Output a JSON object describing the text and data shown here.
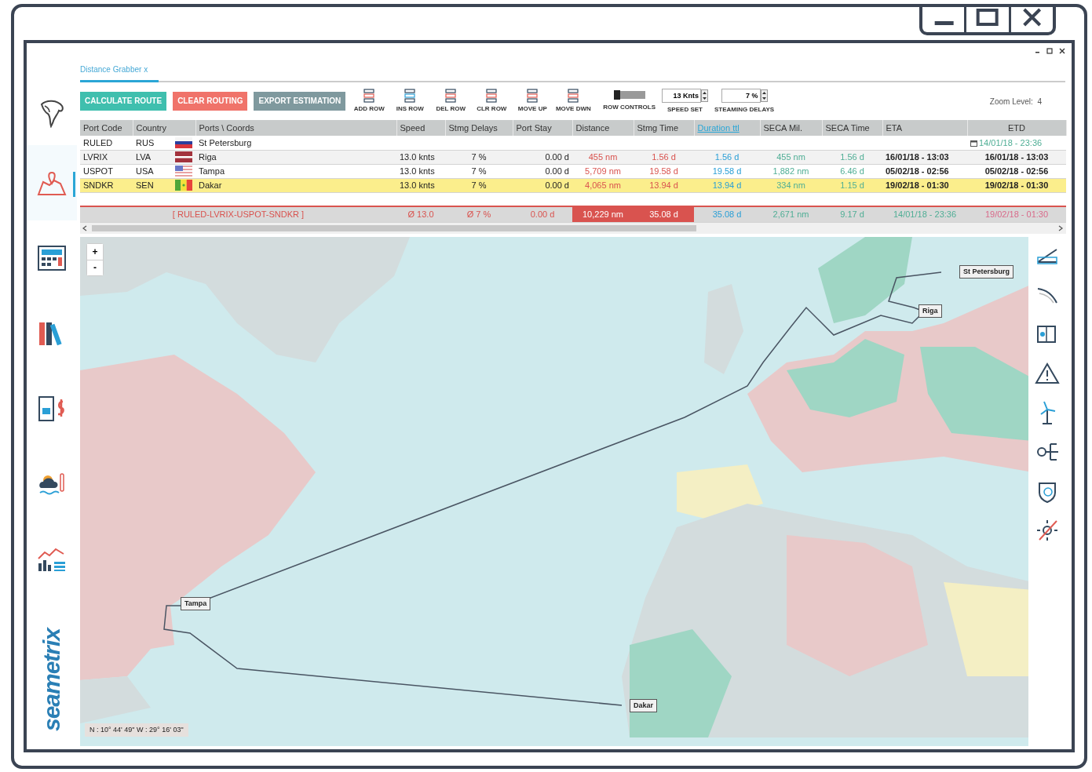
{
  "sidebar": {
    "logo": "seametrix",
    "items": [
      {
        "selected": true
      },
      {
        "selected": false
      },
      {
        "selected": false
      },
      {
        "selected": false
      },
      {
        "selected": false
      },
      {
        "selected": false
      }
    ]
  },
  "tabs": [
    {
      "label": "Distance Grabber x",
      "selected": true
    }
  ],
  "toolbar": {
    "buttons": [
      {
        "label": "CALCULATE ROUTE",
        "color": "#3fbfae"
      },
      {
        "label": "CLEAR ROUTING",
        "color": "#f0736a"
      },
      {
        "label": "EXPORT ESTIMATION",
        "color": "#7f999e"
      }
    ],
    "row_tools": [
      "ADD ROW",
      "INS ROW",
      "DEL ROW",
      "CLR ROW",
      "MOVE UP",
      "MOVE DWN"
    ],
    "row_controls": "ROW CONTROLS",
    "speed": {
      "value": "13 Knts",
      "label": "SPEED SET"
    },
    "delays": {
      "value": "7 %",
      "label": "STEAMING DELAYS"
    },
    "zoom_level": "Zoom Level:  4"
  },
  "table": {
    "columns": [
      {
        "label": "Port Code",
        "selected": false
      },
      {
        "label": "Country",
        "selected": false
      },
      {
        "label": "Ports \\ Coords",
        "selected": false
      },
      {
        "label": "Speed",
        "selected": false
      },
      {
        "label": "Stmg Delays",
        "selected": false
      },
      {
        "label": "Port Stay",
        "selected": false
      },
      {
        "label": "Distance",
        "selected": false
      },
      {
        "label": "Stmg Time",
        "selected": false
      },
      {
        "label": "Duration ttl",
        "selected": true
      },
      {
        "label": "SECA Mil.",
        "selected": false
      },
      {
        "label": "SECA Time",
        "selected": false
      },
      {
        "label": "ETA",
        "selected": false
      },
      {
        "label": "ETD",
        "selected": false
      }
    ],
    "rows": [
      {
        "port_code": "RULED",
        "country": "RUS",
        "port": "St Petersburg",
        "speed": "",
        "stmg_delays": "",
        "port_stay": "",
        "distance": "",
        "stmg_time": "",
        "duration": "",
        "seca_mil": "",
        "seca_time": "",
        "eta": "",
        "etd": "14/01/18 - 23:36",
        "selected": false
      },
      {
        "port_code": "LVRIX",
        "country": "LVA",
        "port": "Riga",
        "speed": "13.0 knts",
        "stmg_delays": "7 %",
        "port_stay": "0.00 d",
        "distance": "455 nm",
        "stmg_time": "1.56 d",
        "duration": "1.56 d",
        "seca_mil": "455 nm",
        "seca_time": "1.56 d",
        "eta": "16/01/18 - 13:03",
        "etd": "16/01/18 - 13:03",
        "selected": false
      },
      {
        "port_code": "USPOT",
        "country": "USA",
        "port": "Tampa",
        "speed": "13.0 knts",
        "stmg_delays": "7 %",
        "port_stay": "0.00 d",
        "distance": "5,709 nm",
        "stmg_time": "19.58 d",
        "duration": "19.58 d",
        "seca_mil": "1,882 nm",
        "seca_time": "6.46 d",
        "eta": "05/02/18 - 02:56",
        "etd": "05/02/18 - 02:56",
        "selected": false
      },
      {
        "port_code": "SNDKR",
        "country": "SEN",
        "port": "Dakar",
        "speed": "13.0 knts",
        "stmg_delays": "7 %",
        "port_stay": "0.00 d",
        "distance": "4,065 nm",
        "stmg_time": "13.94 d",
        "duration": "13.94 d",
        "seca_mil": "334 nm",
        "seca_time": "1.15 d",
        "eta": "19/02/18 - 01:30",
        "etd": "19/02/18 - 01:30",
        "selected": true
      }
    ],
    "summary": {
      "route": "[ RULED-LVRIX-USPOT-SNDKR ]",
      "speed": "Ø 13.0",
      "stmg_delays": "Ø 7 %",
      "port_stay": "0.00 d",
      "distance": "10,229 nm",
      "stmg_time": "35.08 d",
      "duration": "35.08 d",
      "seca_mil": "2,671 nm",
      "seca_time": "9.17 d",
      "eta": "14/01/18 - 23:36",
      "etd": "19/02/18 - 01:30"
    }
  },
  "map": {
    "zoom_buttons": [
      "+",
      "-"
    ],
    "port_labels": [
      "St Petersburg",
      "Riga",
      "Tampa",
      "Dakar"
    ],
    "coordinates": "N : 10° 44' 49\" W : 29° 16' 03\""
  }
}
